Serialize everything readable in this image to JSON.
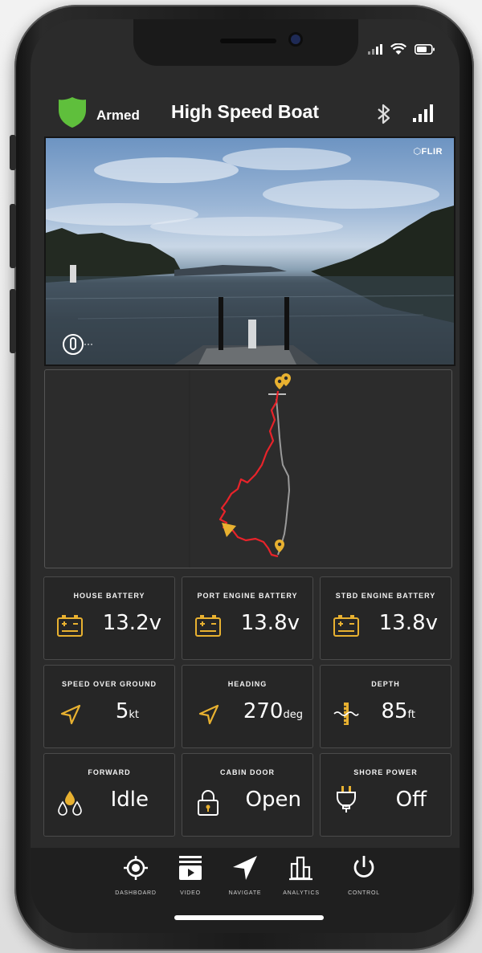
{
  "status_bar": {
    "icons": [
      "signal-icon",
      "wifi-icon",
      "battery-icon"
    ]
  },
  "header": {
    "security_status": "Armed",
    "title": "High Speed Boat",
    "icons": [
      "shield-icon",
      "bluetooth-icon",
      "signal-icon"
    ]
  },
  "video": {
    "watermark": "FLIR"
  },
  "tiles": [
    {
      "title": "HOUSE BATTERY",
      "value": "13.2v",
      "unit": "",
      "icon": "battery-icon"
    },
    {
      "title": "PORT ENGINE BATTERY",
      "value": "13.8v",
      "unit": "",
      "icon": "battery-icon"
    },
    {
      "title": "STBD ENGINE BATTERY",
      "value": "13.8v",
      "unit": "",
      "icon": "battery-icon"
    },
    {
      "title": "SPEED OVER GROUND",
      "value": "5",
      "unit": "kt",
      "icon": "navigation-arrow-icon"
    },
    {
      "title": "HEADING",
      "value": "270",
      "unit": "deg",
      "icon": "navigation-arrow-icon"
    },
    {
      "title": "DEPTH",
      "value": "85",
      "unit": "ft",
      "icon": "depth-gauge-icon"
    },
    {
      "title": "FORWARD",
      "value": "Idle",
      "unit": "",
      "icon": "bilge-drops-icon"
    },
    {
      "title": "CABIN DOOR",
      "value": "Open",
      "unit": "",
      "icon": "lock-icon"
    },
    {
      "title": "SHORE POWER",
      "value": "Off",
      "unit": "",
      "icon": "plug-icon"
    }
  ],
  "bottom_nav": [
    {
      "label": "DASHBOARD",
      "icon": "crosshair-icon"
    },
    {
      "label": "VIDEO",
      "icon": "video-icon"
    },
    {
      "label": "NAVIGATE",
      "icon": "navigate-arrow-icon"
    },
    {
      "label": "ANALYTICS",
      "icon": "analytics-icon"
    },
    {
      "label": "CONTROL",
      "icon": "power-icon"
    }
  ],
  "colors": {
    "accent": "#e8b130",
    "track_red": "#e8232a",
    "track_gray": "#9a9a9a",
    "shield_green": "#5fbf3c",
    "background": "#2b2b2b"
  }
}
